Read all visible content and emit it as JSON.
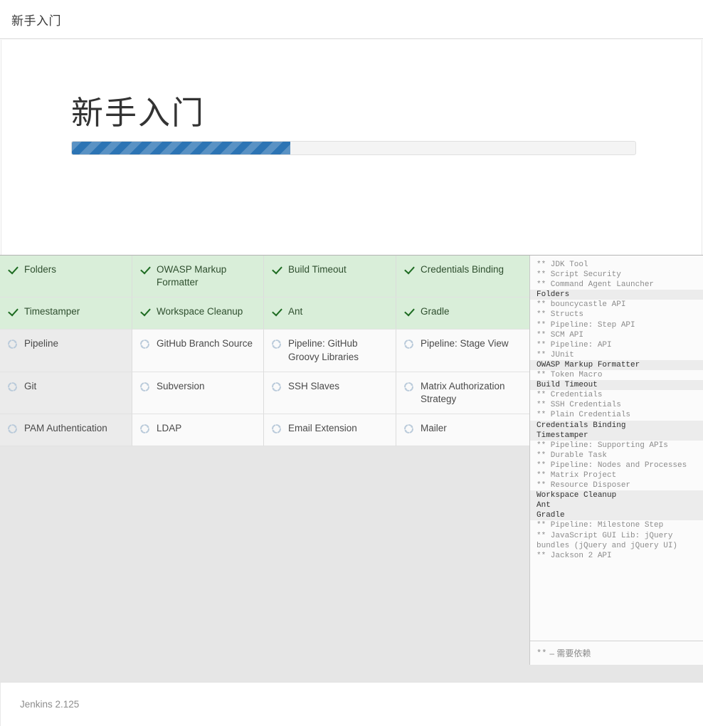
{
  "header": {
    "title": "新手入门"
  },
  "hero": {
    "title": "新手入门",
    "progress_percent": 38.7,
    "progress_fill_color": "#2c74b4",
    "progress_track_color": "#f4f4f4"
  },
  "plugins": {
    "status_done": "done",
    "status_pending": "pending",
    "items": [
      {
        "label": "Folders",
        "status": "done",
        "column": 1
      },
      {
        "label": "OWASP Markup Formatter",
        "status": "done",
        "column": 2
      },
      {
        "label": "Build Timeout",
        "status": "done",
        "column": 3
      },
      {
        "label": "Credentials Binding",
        "status": "done",
        "column": 4
      },
      {
        "label": "Timestamper",
        "status": "done",
        "column": 1
      },
      {
        "label": "Workspace Cleanup",
        "status": "done",
        "column": 2
      },
      {
        "label": "Ant",
        "status": "done",
        "column": 3
      },
      {
        "label": "Gradle",
        "status": "done",
        "column": 4
      },
      {
        "label": "Pipeline",
        "status": "pending",
        "column": 1
      },
      {
        "label": "GitHub Branch Source",
        "status": "pending",
        "column": 2
      },
      {
        "label": "Pipeline: GitHub Groovy Libraries",
        "status": "pending",
        "column": 3
      },
      {
        "label": "Pipeline: Stage View",
        "status": "pending",
        "column": 4
      },
      {
        "label": "Git",
        "status": "pending",
        "column": 1
      },
      {
        "label": "Subversion",
        "status": "pending",
        "column": 2
      },
      {
        "label": "SSH Slaves",
        "status": "pending",
        "column": 3
      },
      {
        "label": "Matrix Authorization Strategy",
        "status": "pending",
        "column": 4
      },
      {
        "label": "PAM Authentication",
        "status": "pending",
        "column": 1
      },
      {
        "label": "LDAP",
        "status": "pending",
        "column": 2
      },
      {
        "label": "Email Extension",
        "status": "pending",
        "column": 3
      },
      {
        "label": "Mailer",
        "status": "pending",
        "column": 4
      }
    ]
  },
  "log": {
    "lines": [
      {
        "text": "** JDK Tool",
        "top_level": false
      },
      {
        "text": "** Script Security",
        "top_level": false
      },
      {
        "text": "** Command Agent Launcher",
        "top_level": false
      },
      {
        "text": "Folders",
        "top_level": true
      },
      {
        "text": "** bouncycastle API",
        "top_level": false
      },
      {
        "text": "** Structs",
        "top_level": false
      },
      {
        "text": "** Pipeline: Step API",
        "top_level": false
      },
      {
        "text": "** SCM API",
        "top_level": false
      },
      {
        "text": "** Pipeline: API",
        "top_level": false
      },
      {
        "text": "** JUnit",
        "top_level": false
      },
      {
        "text": "OWASP Markup Formatter",
        "top_level": true
      },
      {
        "text": "** Token Macro",
        "top_level": false
      },
      {
        "text": "Build Timeout",
        "top_level": true
      },
      {
        "text": "** Credentials",
        "top_level": false
      },
      {
        "text": "** SSH Credentials",
        "top_level": false
      },
      {
        "text": "** Plain Credentials",
        "top_level": false
      },
      {
        "text": "Credentials Binding",
        "top_level": true
      },
      {
        "text": "Timestamper",
        "top_level": true
      },
      {
        "text": "** Pipeline: Supporting APIs",
        "top_level": false
      },
      {
        "text": "** Durable Task",
        "top_level": false
      },
      {
        "text": "** Pipeline: Nodes and Processes",
        "top_level": false
      },
      {
        "text": "** Matrix Project",
        "top_level": false
      },
      {
        "text": "** Resource Disposer",
        "top_level": false
      },
      {
        "text": "Workspace Cleanup",
        "top_level": true
      },
      {
        "text": "Ant",
        "top_level": true
      },
      {
        "text": "Gradle",
        "top_level": true
      },
      {
        "text": "** Pipeline: Milestone Step",
        "top_level": false
      },
      {
        "text": "** JavaScript GUI Lib: jQuery bundles (jQuery and jQuery UI)",
        "top_level": false
      },
      {
        "text": "** Jackson 2 API",
        "top_level": false
      }
    ],
    "legend_marker": "**",
    "legend_text": "– 需要依赖"
  },
  "footer": {
    "version": "Jenkins 2.125"
  }
}
